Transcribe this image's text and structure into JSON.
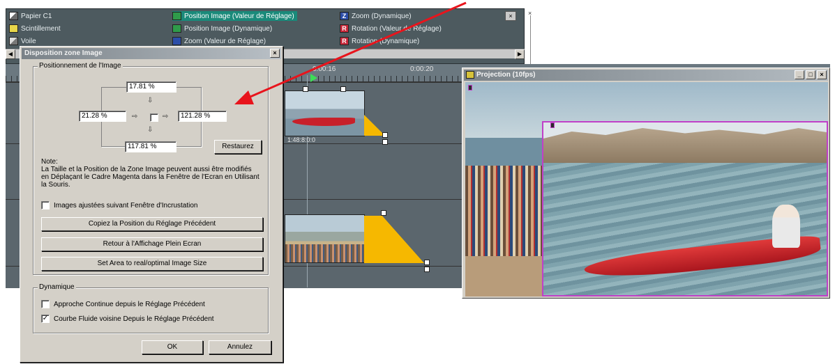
{
  "effects": {
    "col1": [
      {
        "icon": "paper-icon",
        "label": "Papier C1"
      },
      {
        "icon": "scintillement-icon",
        "label": "Scintillement"
      },
      {
        "icon": "voile-icon",
        "label": "Voile"
      }
    ],
    "col2": [
      {
        "icon": "position-icon",
        "label": "Position Image (Valeur de Réglage)"
      },
      {
        "icon": "position-icon",
        "label": "Position Image (Dynamique)"
      },
      {
        "icon": "zoom-icon",
        "label": "Zoom (Valeur de Réglage)"
      }
    ],
    "col3": [
      {
        "icon": "zoom-icon",
        "label": "Zoom (Dynamique)",
        "badge": "Z"
      },
      {
        "icon": "rotation-icon",
        "label": "Rotation (Valeur de Réglage)",
        "badge": "R"
      },
      {
        "icon": "rotation-icon",
        "label": "Rotation (Dynamique)",
        "badge": "R"
      }
    ],
    "close_glyph": "×",
    "side_glyph": "×"
  },
  "timeline": {
    "markers": [
      "0:00:16",
      "0:00:20"
    ],
    "clip1_timecode": "1:48:8:0:0"
  },
  "dialog": {
    "title": "Disposition zone Image",
    "close_glyph": "×",
    "positioning_group": "Positionnement de l'Image",
    "top_value": "17.81 %",
    "left_value": "21.28 %",
    "right_value": "121.28 %",
    "bottom_value": "117.81 %",
    "restore_button": "Restaurez",
    "note_title": "Note:",
    "note_text": "La Taille et la Position de la Zone Image peuvent aussi être modifiés en Déplaçant le Cadre Magenta dans la Fenêtre de l'Ecran en Utilisant la Souris.",
    "keying_checkbox": "Images ajustées suivant Fenêtre d'Incrustation",
    "copy_button": "Copiez la Position du Réglage Précédent",
    "fullscreen_button": "Retour à l'Affichage Plein Ecran",
    "optimal_button": "Set Area to real/optimal Image Size",
    "dynamic_group": "Dynamique",
    "continuous_checkbox": "Approche Continue depuis le Réglage Précédent",
    "continuous_checked": false,
    "smooth_checkbox": "Courbe Fluide voisine Depuis le Réglage Précédent",
    "smooth_checked": true,
    "smooth_mark": "✓",
    "ok_button": "OK",
    "cancel_button": "Annulez"
  },
  "projection": {
    "title": "Projection (10fps)",
    "minimize": "_",
    "maximize": "□",
    "close": "×"
  },
  "colors": {
    "annotation_arrow": "#e8141c",
    "image_frame": "#c040c8",
    "selection": "#1a8a7a"
  }
}
